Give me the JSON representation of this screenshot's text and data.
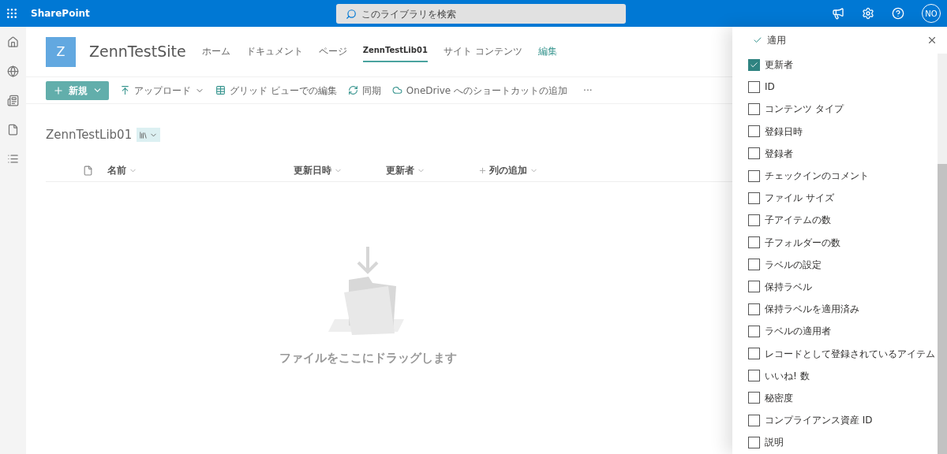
{
  "app_name": "SharePoint",
  "search": {
    "placeholder": "このライブラリを検索"
  },
  "avatar": "NO",
  "site": {
    "logo": "Z",
    "title": "ZennTestSite"
  },
  "nav": [
    {
      "label": "ホーム",
      "selected": false
    },
    {
      "label": "ドキュメント",
      "selected": false
    },
    {
      "label": "ページ",
      "selected": false
    },
    {
      "label": "ZennTestLib01",
      "selected": true
    },
    {
      "label": "サイト コンテンツ",
      "selected": false
    },
    {
      "label": "編集",
      "selected": false,
      "kind": "link"
    }
  ],
  "toolbar": {
    "new": "新規",
    "items": [
      {
        "label": "アップロード",
        "dropdown": true
      },
      {
        "label": "グリッド ビューでの編集",
        "dropdown": false
      },
      {
        "label": "同期",
        "dropdown": false
      },
      {
        "label": "OneDrive へのショートカットの追加",
        "dropdown": false
      }
    ],
    "more": "···"
  },
  "library_title": "ZennTestLib01",
  "columns": [
    "名前",
    "更新日時",
    "更新者"
  ],
  "add_column": "列の追加",
  "empty_message": "ファイルをここにドラッグします",
  "panel": {
    "apply": "適用",
    "items": [
      {
        "label": "更新者",
        "checked": true
      },
      {
        "label": "ID",
        "checked": false
      },
      {
        "label": "コンテンツ タイプ",
        "checked": false
      },
      {
        "label": "登録日時",
        "checked": false
      },
      {
        "label": "登録者",
        "checked": false
      },
      {
        "label": "チェックインのコメント",
        "checked": false
      },
      {
        "label": "ファイル サイズ",
        "checked": false
      },
      {
        "label": "子アイテムの数",
        "checked": false
      },
      {
        "label": "子フォルダーの数",
        "checked": false
      },
      {
        "label": "ラベルの設定",
        "checked": false
      },
      {
        "label": "保持ラベル",
        "checked": false
      },
      {
        "label": "保持ラベルを適用済み",
        "checked": false
      },
      {
        "label": "ラベルの適用者",
        "checked": false
      },
      {
        "label": "レコードとして登録されているアイテム",
        "checked": false
      },
      {
        "label": "いいね! 数",
        "checked": false
      },
      {
        "label": "秘密度",
        "checked": false
      },
      {
        "label": "コンプライアンス資産 ID",
        "checked": false
      },
      {
        "label": "説明",
        "checked": false
      }
    ]
  }
}
